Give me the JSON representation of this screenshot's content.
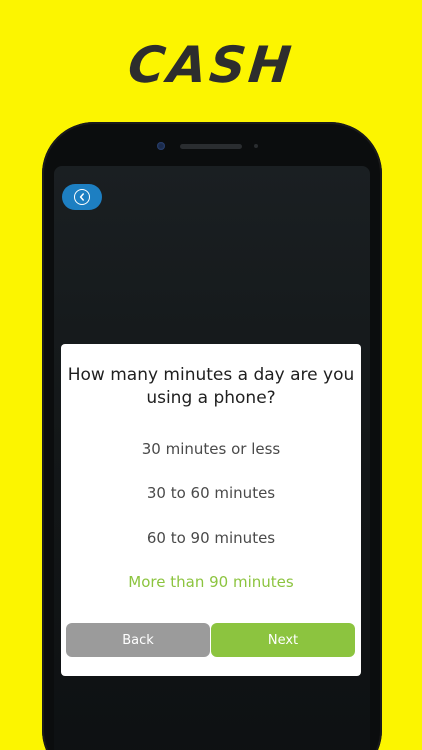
{
  "app": {
    "brand_title": "CASH"
  },
  "nav": {
    "back_icon": "chevron-left-circle-icon"
  },
  "quiz": {
    "question": "How many minutes a day are you using a phone?",
    "options": [
      {
        "label": "30 minutes or less",
        "selected": false
      },
      {
        "label": "30 to 60 minutes",
        "selected": false
      },
      {
        "label": "60 to 90 minutes",
        "selected": false
      },
      {
        "label": "More than 90 minutes",
        "selected": true
      }
    ],
    "back_label": "Back",
    "next_label": "Next"
  },
  "colors": {
    "background": "#fcf500",
    "accent_green": "#8cc43f",
    "back_button_gray": "#9b9b9b",
    "nav_blue": "#1d7fc2"
  }
}
